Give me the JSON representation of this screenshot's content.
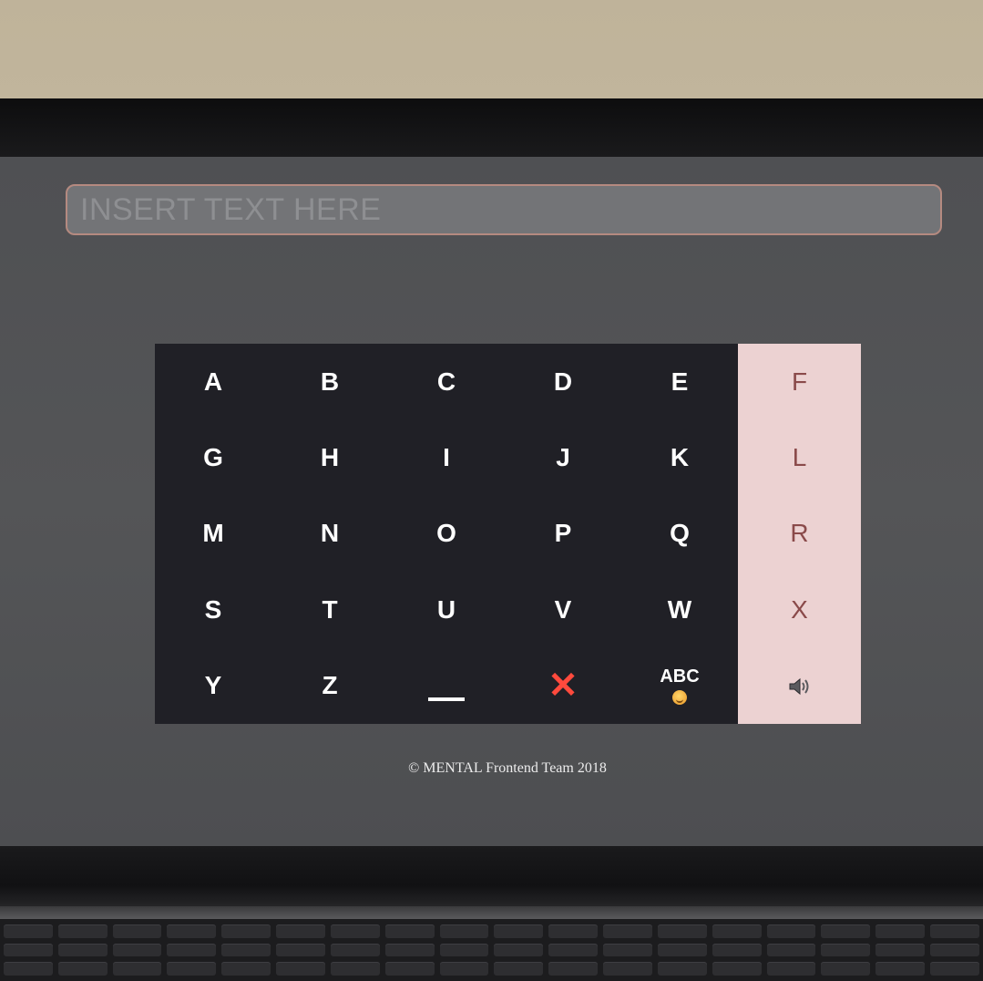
{
  "input": {
    "placeholder": "INSERT TEXT HERE",
    "value": ""
  },
  "keypad": {
    "rows": [
      [
        "A",
        "B",
        "C",
        "D",
        "E"
      ],
      [
        "G",
        "H",
        "I",
        "J",
        "K"
      ],
      [
        "M",
        "N",
        "O",
        "P",
        "Q"
      ],
      [
        "S",
        "T",
        "U",
        "V",
        "W"
      ],
      [
        "Y",
        "Z"
      ]
    ],
    "highlighted_column": [
      "F",
      "L",
      "R",
      "X"
    ],
    "special_keys": {
      "space": "space-icon",
      "delete": "✕",
      "abc_label": "ABC",
      "emoji": "smiley-emoji-icon",
      "speaker": "speaker-icon"
    },
    "colors": {
      "grid_bg": "#202026",
      "highlight_bg": "#ecd2d2",
      "highlight_text": "#8a4a4a",
      "delete": "#ff4a3d"
    }
  },
  "footer": {
    "text": "© MENTAL Frontend Team 2018"
  }
}
